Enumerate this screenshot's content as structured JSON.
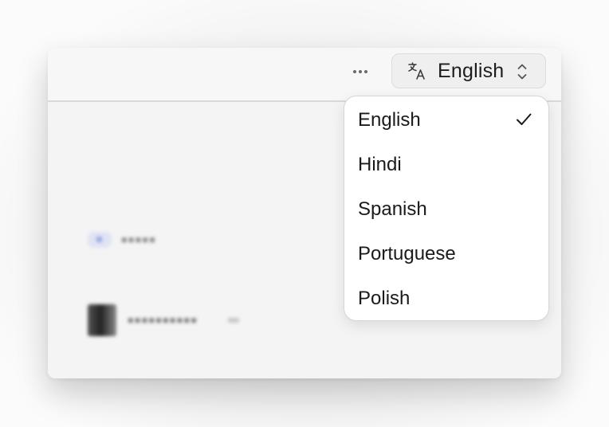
{
  "header": {
    "more_icon": "ellipsis-icon",
    "language_button": {
      "icon": "translate-icon",
      "label": "English",
      "chevron": "chevron-up-down-icon"
    }
  },
  "language_menu": {
    "selected": "English",
    "check_icon": "check-icon",
    "items": [
      {
        "label": "English",
        "selected": true
      },
      {
        "label": "Hindi",
        "selected": false
      },
      {
        "label": "Spanish",
        "selected": false
      },
      {
        "label": "Portuguese",
        "selected": false
      },
      {
        "label": "Polish",
        "selected": false
      }
    ]
  },
  "colors": {
    "window_bg": "#f4f4f4",
    "text": "#1a1a1a",
    "border": "#d6d6d6"
  }
}
